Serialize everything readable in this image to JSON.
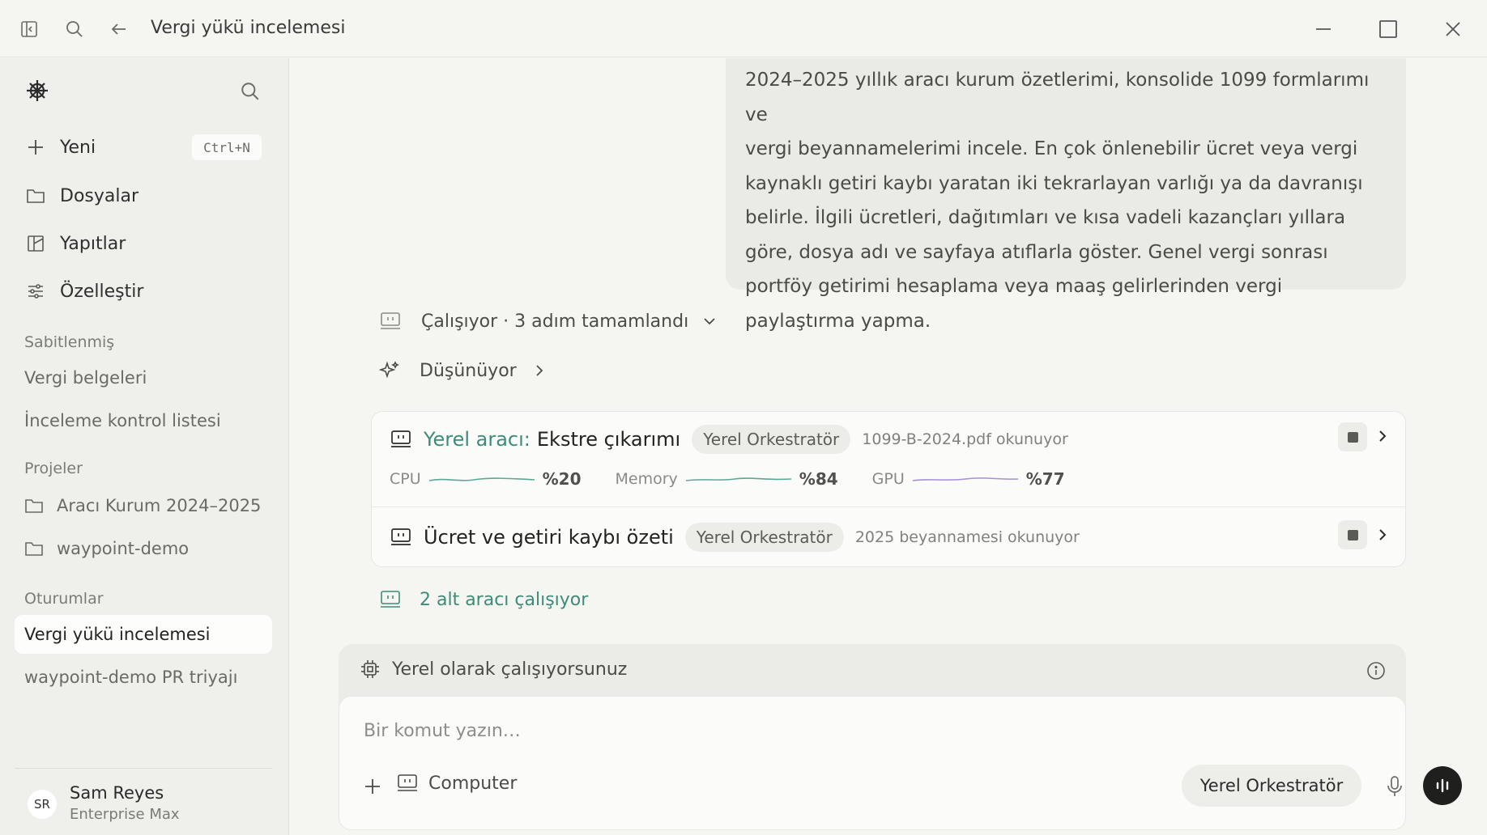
{
  "window": {
    "title": "Vergi yükü incelemesi",
    "icons": [
      "sidebar-toggle-icon",
      "search-icon",
      "back-arrow-icon",
      "minimize-icon",
      "maximize-icon",
      "close-icon"
    ]
  },
  "sidebar": {
    "new_label": "Yeni",
    "new_shortcut": "Ctrl+N",
    "nav": [
      {
        "label": "Dosyalar",
        "icon": "folder-icon"
      },
      {
        "label": "Yapıtlar",
        "icon": "artifacts-icon"
      },
      {
        "label": "Özelleştir",
        "icon": "sliders-icon"
      }
    ],
    "pinned_heading": "Sabitlenmiş",
    "pinned": [
      "Vergi belgeleri",
      "İnceleme kontrol listesi"
    ],
    "projects_heading": "Projeler",
    "projects": [
      "Aracı Kurum 2024–2025",
      "waypoint-demo"
    ],
    "sessions_heading": "Oturumlar",
    "sessions": [
      "Vergi yükü incelemesi",
      "waypoint-demo PR triyajı"
    ],
    "user": {
      "initials": "SR",
      "name": "Sam Reyes",
      "plan": "Enterprise Max"
    }
  },
  "chat": {
    "user_message_lines": [
      "2024–2025 yıllık aracı kurum özetlerimi, konsolide 1099 formlarımı ve",
      "vergi beyannamelerimi incele. En çok önlenebilir ücret veya vergi",
      "kaynaklı getiri kaybı yaratan iki tekrarlayan varlığı ya da davranışı",
      "belirle. İlgili ücretleri, dağıtımları ve kısa vadeli kazançları yıllara",
      "göre, dosya adı ve sayfaya atıflarla göster. Genel vergi sonrası",
      "portföy getirimi hesaplama veya maaş gelirlerinden vergi",
      "paylaştırma yapma."
    ],
    "status": "Çalışıyor · 3 adım tamamlandı",
    "thinking": "Düşünüyor",
    "agents": [
      {
        "prefix": "Yerel aracı:",
        "title": "Ekstre çıkarımı",
        "badge": "Yerel Orkestratör",
        "activity": "1099-B-2024.pdf okunuyor",
        "metrics": [
          {
            "label": "CPU",
            "value": "%20",
            "color": "#5aa897"
          },
          {
            "label": "Memory",
            "value": "%84",
            "color": "#5aa897"
          },
          {
            "label": "GPU",
            "value": "%77",
            "color": "#a58fd6"
          }
        ]
      },
      {
        "prefix": "",
        "title": "Ücret ve getiri kaybı özeti",
        "badge": "Yerel Orkestratör",
        "activity": "2025 beyannamesi okunuyor"
      }
    ],
    "sub_agents_label": "2 alt aracı çalışıyor"
  },
  "composer": {
    "local_banner": "Yerel olarak çalışıyorsunuz",
    "placeholder": "Bir komut yazın…",
    "computer_label": "Computer",
    "model_label": "Yerel Orkestratör"
  },
  "colors": {
    "accent_green": "#3d8c78",
    "background": "#f5f5f2",
    "sidebar": "#efefec"
  }
}
